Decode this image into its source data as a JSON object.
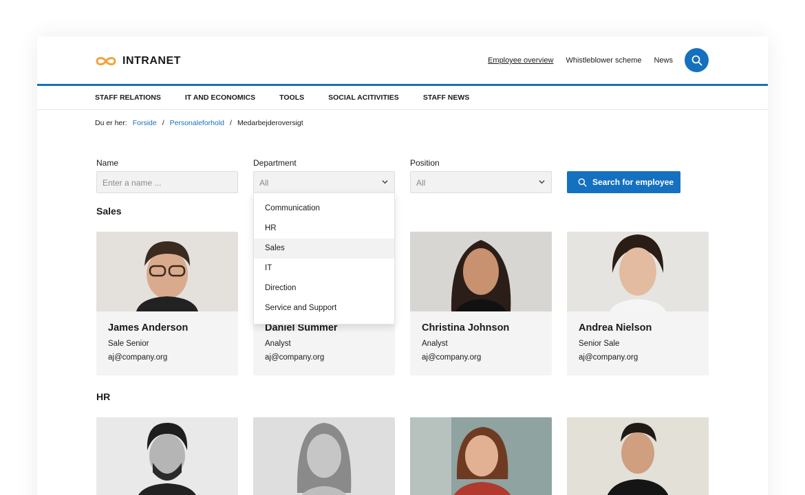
{
  "brand": {
    "name": "INTRANET",
    "accent": "#1570c0",
    "logo_color": "#f2a33a"
  },
  "top_links": [
    "Employee overview",
    "Whistleblower scheme",
    "News"
  ],
  "nav": [
    "STAFF RELATIONS",
    "IT AND ECONOMICS",
    "TOOLS",
    "SOCIAL ACITIVITIES",
    "STAFF NEWS"
  ],
  "breadcrumb": {
    "prefix": "Du er her:",
    "items": [
      "Forside",
      "Personaleforhold",
      "Medarbejderoversigt"
    ],
    "sep": "/"
  },
  "filters": {
    "name_label": "Name",
    "name_placeholder": "Enter a name ...",
    "department_label": "Department",
    "department_value": "All",
    "position_label": "Position",
    "position_value": "All",
    "search_label": "Search for employee"
  },
  "department_options": [
    "Communication",
    "HR",
    "Sales",
    "IT",
    "Direction",
    "Service and Support"
  ],
  "highlighted_option": "Sales",
  "sections": [
    {
      "title": "Sales",
      "employees": [
        {
          "name": "James Anderson",
          "role": "Sale Senior",
          "email": "aj@company.org"
        },
        {
          "name": "Daniel Summer",
          "role": "Analyst",
          "email": "aj@company.org"
        },
        {
          "name": "Christina Johnson",
          "role": "Analyst",
          "email": "aj@company.org"
        },
        {
          "name": "Andrea Nielson",
          "role": "Senior Sale",
          "email": "aj@company.org"
        }
      ]
    },
    {
      "title": "HR",
      "employees": [
        {},
        {},
        {},
        {}
      ]
    }
  ]
}
